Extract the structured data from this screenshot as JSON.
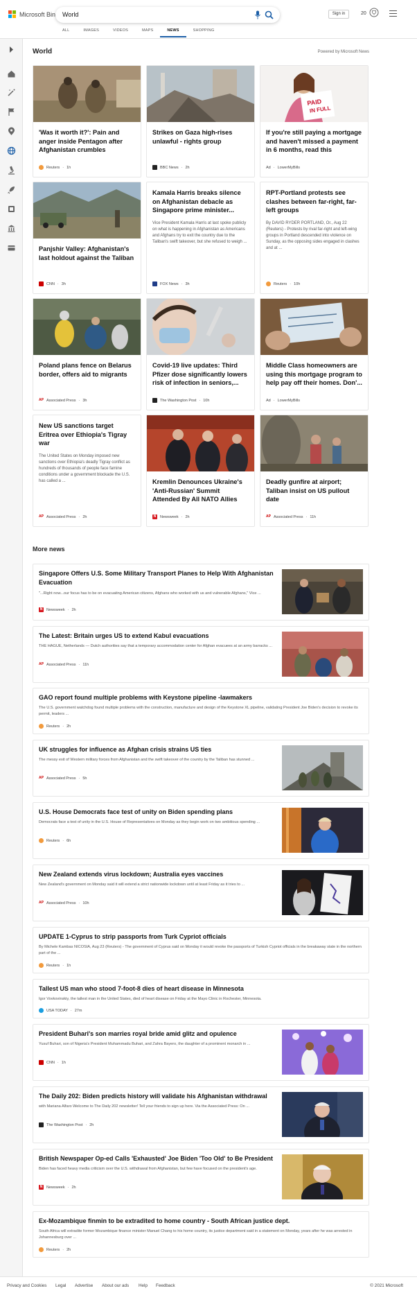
{
  "header": {
    "logo_text": "Microsoft Bing",
    "search_value": "World",
    "signin_label": "Sign in",
    "rewards_count": "20",
    "brand_colors": [
      "#f25022",
      "#7fba00",
      "#00a4ef",
      "#ffb900"
    ],
    "accent": "#1b5ea7"
  },
  "scopes": [
    "ALL",
    "IMAGES",
    "VIDEOS",
    "MAPS",
    "NEWS",
    "SHOPPING"
  ],
  "active_scope": "NEWS",
  "section": {
    "title": "World",
    "powered": "Powered by Microsoft News"
  },
  "cards": [
    {
      "title": "'Was it worth it?': Pain and anger inside Pentagon after Afghanistan crumbles",
      "snippet": "",
      "source": "Reuters",
      "time": "1h",
      "icon": "reuters-icon"
    },
    {
      "title": "Strikes on Gaza high-rises unlawful - rights group",
      "snippet": "",
      "source": "BBC News",
      "time": "2h",
      "icon": "bbc-icon"
    },
    {
      "title": "If you're still paying a mortgage and haven't missed a payment in 6 months, read this",
      "snippet": "",
      "source": "LowerMyBills",
      "time": "",
      "ad": "Ad",
      "icon": ""
    },
    {
      "title": "Panjshir Valley: Afghanistan's last holdout against the Taliban",
      "snippet": "",
      "source": "CNN",
      "time": "3h",
      "icon": "cnn-icon"
    },
    {
      "title": "Kamala Harris breaks silence on Afghanistan debacle as Singapore prime minister...",
      "snippet": "Vice President Kamala Harris at last spoke publicly on what is happening in Afghanistan as Americans and Afghans try to exit the country due to the Taliban's swift takeover, but she refused to weigh ...",
      "source": "FOX News",
      "time": "3h",
      "icon": "fox-icon"
    },
    {
      "title": "RPT-Portland protests see clashes between far-right, far-left groups",
      "snippet": "By DAVID RYDER PORTLAND, Or., Aug 22 (Reuters) - Protests by rival far-right and left-wing groups in Portland descended into violence on Sunday, as the opposing sides engaged in clashes and at ...",
      "source": "Reuters",
      "time": "10h",
      "icon": "reuters-icon"
    },
    {
      "title": "Poland plans fence on Belarus border, offers aid to migrants",
      "snippet": "",
      "source": "Associated Press",
      "time": "3h",
      "icon": "ap-icon"
    },
    {
      "title": "Covid-19 live updates: Third Pfizer dose significantly lowers risk of infection in seniors,...",
      "snippet": "",
      "source": "The Washington Post",
      "time": "10h",
      "icon": "wapo-icon"
    },
    {
      "title": "Middle Class homeowners are using this mortgage program to help pay off their homes. Don'...",
      "snippet": "",
      "source": "LowerMyBills",
      "time": "",
      "ad": "Ad",
      "icon": ""
    },
    {
      "title": "New US sanctions target Eritrea over Ethiopia's Tigray war",
      "snippet": "The United States on Monday imposed new sanctions over Ethiopia's deadly Tigray conflict as hundreds of thousands of people face famine conditions under a government blockade the U.S. has called a ...",
      "source": "Associated Press",
      "time": "2h",
      "icon": "ap-icon"
    },
    {
      "title": "Kremlin Denounces Ukraine's 'Anti-Russian' Summit Attended By All NATO Allies",
      "snippet": "",
      "source": "Newsweek",
      "time": "2h",
      "icon": "newsweek-icon"
    },
    {
      "title": "Deadly gunfire at airport; Taliban insist on US pullout date",
      "snippet": "",
      "source": "Associated Press",
      "time": "11h",
      "icon": "ap-icon"
    }
  ],
  "more_news_title": "More news",
  "more_news": [
    {
      "title": "Singapore Offers U.S. Some Military Transport Planes to Help With Afghanistan Evacuation",
      "snippet": "\"...Right now...our focus has to be on evacuating American citizens, Afghans who worked with us and vulnerable Afghans,\" Vice ...",
      "source": "Newsweek",
      "time": "2h"
    },
    {
      "title": "The Latest: Britain urges US to extend Kabul evacuations",
      "snippet": "THE HAGUE, Netherlands — Dutch authorities say that a temporary accommodation center for Afghan evacuees at an army barracks ...",
      "source": "Associated Press",
      "time": "11h"
    },
    {
      "title": "GAO report found multiple problems with Keystone pipeline -lawmakers",
      "snippet": "The U.S. government watchdog found multiple problems with the construction, manufacture and design of the Keystone XL pipeline, validating President Joe Biden's decision to revoke its permit, leaders ...",
      "source": "Reuters",
      "time": "2h"
    },
    {
      "title": "UK struggles for influence as Afghan crisis strains US ties",
      "snippet": "The messy exit of Western military forces from Afghanistan and the swift takeover of the country by the Taliban has stunned ...",
      "source": "Associated Press",
      "time": "5h"
    },
    {
      "title": "U.S. House Democrats face test of unity on Biden spending plans",
      "snippet": "Democrats face a test of unity in the U.S. House of Representatives on Monday as they begin work on two ambitious spending ...",
      "source": "Reuters",
      "time": "6h"
    },
    {
      "title": "New Zealand extends virus lockdown; Australia eyes vaccines",
      "snippet": "New Zealand's government on Monday said it will extend a strict nationwide lockdown until at least Friday as it tries to ...",
      "source": "Associated Press",
      "time": "10h"
    },
    {
      "title": "UPDATE 1-Cyprus to strip passports from Turk Cypriot officials",
      "snippet": "By Michele Kambas NICOSIA, Aug 23 (Reuters) - The government of Cyprus said on Monday it would revoke the passports of Turkish Cypriot officials in the breakaway state in the northern part of the ...",
      "source": "Reuters",
      "time": "1h"
    },
    {
      "title": "Tallest US man who stood 7-foot-8 dies of heart disease in Minnesota",
      "snippet": "Igor Vovkovinskiy, the tallest man in the United States, died of heart disease on Friday at the Mayo Clinic in Rochester, Minnesota.",
      "source": "USA TODAY",
      "time": "27m"
    },
    {
      "title": "President Buhari's son marries royal bride amid glitz and opulence",
      "snippet": "Yusuf Buhari, son of Nigeria's President Muhammadu Buhari, and Zahra Bayero, the daughter of a prominent monarch in ...",
      "source": "CNN",
      "time": "1h"
    },
    {
      "title": "The Daily 202: Biden predicts history will validate his Afghanistan withdrawal",
      "snippet": "with Mariana Alfaro Welcome to The Daily 202 newsletter! Tell your friends to sign up here. Via the Associated Press: On ...",
      "source": "The Washington Post",
      "time": "2h"
    },
    {
      "title": "British Newspaper Op-ed Calls 'Exhausted' Joe Biden 'Too Old' to Be President",
      "snippet": "Biden has faced heavy media criticism over the U.S. withdrawal from Afghanistan, but few have focused on the president's age.",
      "source": "Newsweek",
      "time": "2h"
    },
    {
      "title": "Ex-Mozambique finmin to be extradited to home country - South African justice dept.",
      "snippet": "South Africa will extradite former Mozambique finance minister Manuel Chang to his home country, its justice department said in a statement on Monday, years after he was arrested in Johannesburg over ...",
      "source": "Reuters",
      "time": "2h"
    }
  ],
  "footer": {
    "links": [
      "Privacy and Cookies",
      "Legal",
      "Advertise",
      "About our ads",
      "Help",
      "Feedback"
    ],
    "copyright": "© 2021 Microsoft"
  }
}
